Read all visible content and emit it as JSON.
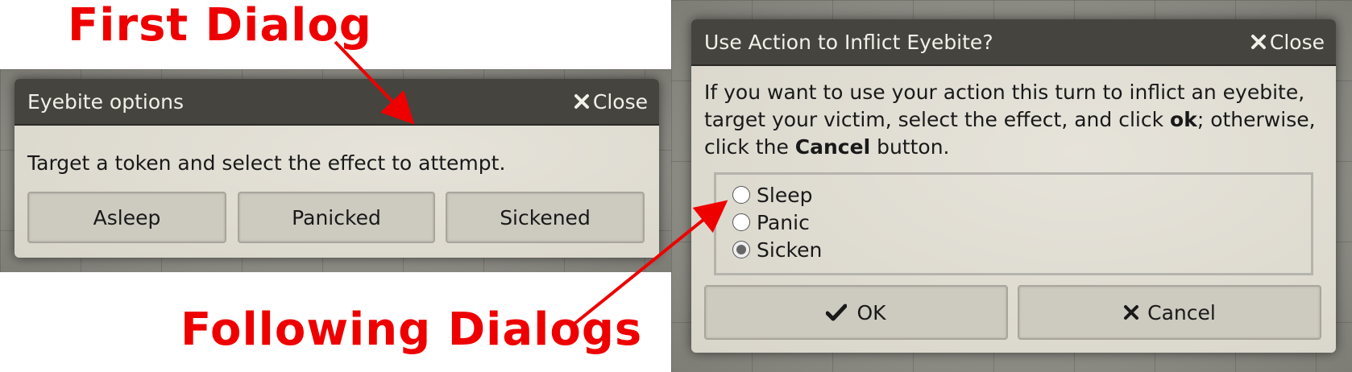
{
  "annotations": {
    "first": "First Dialog",
    "following": "Following Dialogs"
  },
  "dialog1": {
    "title": "Eyebite options",
    "close_label": "Close",
    "message": "Target a token and select the effect to attempt.",
    "buttons": [
      "Asleep",
      "Panicked",
      "Sickened"
    ]
  },
  "dialog2": {
    "title": "Use Action to Inflict Eyebite?",
    "close_label": "Close",
    "message_part1": "If you want to use your action this turn to inflict an eyebite,",
    "message_part2a": "target your victim, select the effect, and click ",
    "message_bold1": "ok",
    "message_part2b": "; otherwise,",
    "message_part3a": "click the ",
    "message_bold2": "Cancel",
    "message_part3b": " button.",
    "options": [
      {
        "label": "Sleep",
        "checked": false
      },
      {
        "label": "Panic",
        "checked": false
      },
      {
        "label": "Sicken",
        "checked": true
      }
    ],
    "ok_label": "OK",
    "cancel_label": "Cancel"
  },
  "colors": {
    "annotation": "#ee0000",
    "titlebar": "#45443e",
    "dialog_bg": "#dedbd1"
  }
}
